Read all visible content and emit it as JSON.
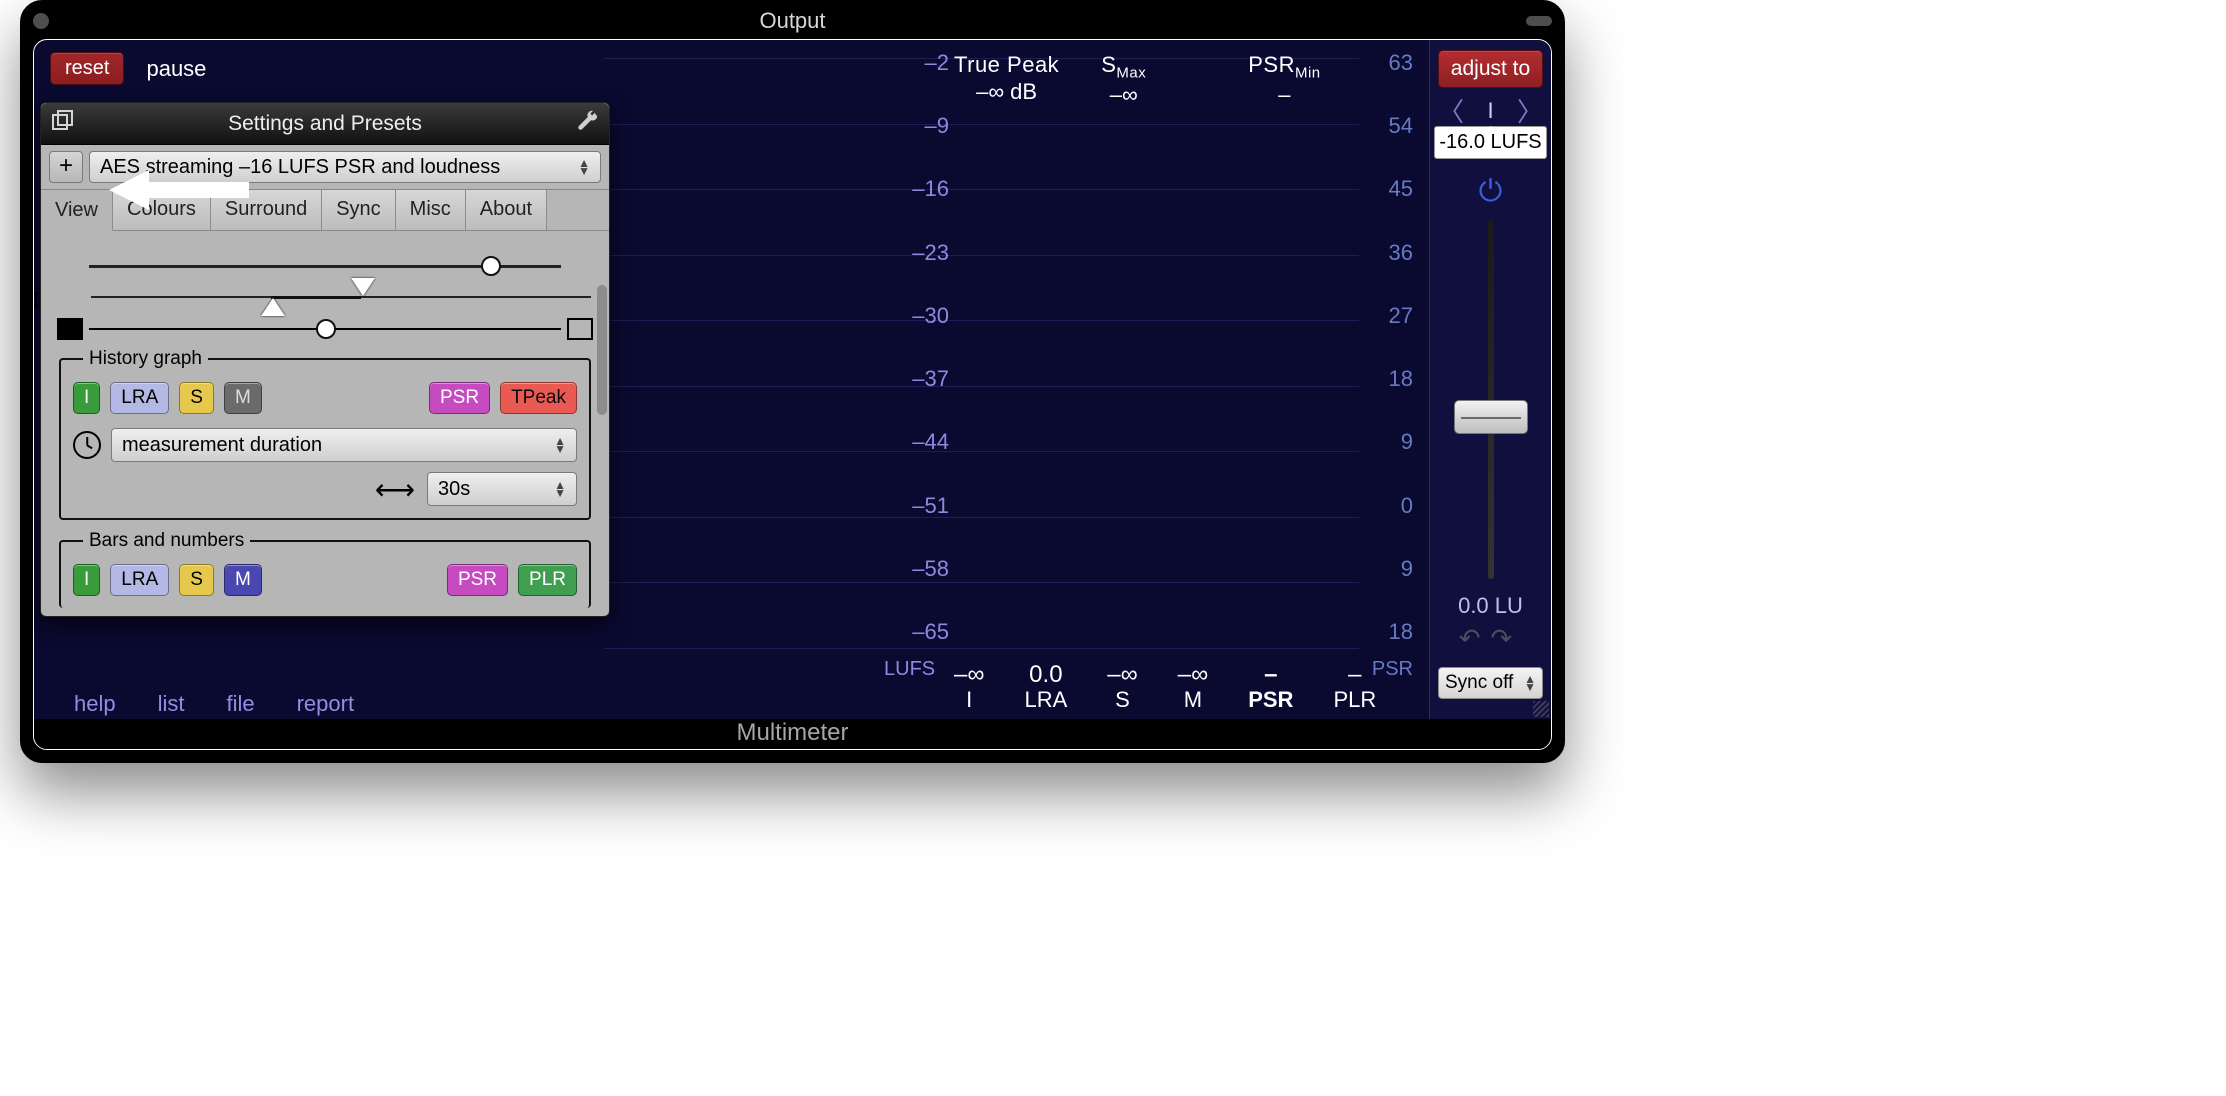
{
  "window": {
    "title": "Output",
    "app_name": "Multimeter"
  },
  "toolbar": {
    "reset_label": "reset",
    "pause_label": "pause"
  },
  "footer_links": [
    "help",
    "list",
    "file",
    "report"
  ],
  "top_stats": {
    "true_peak": {
      "label": "True Peak",
      "value": "–∞ dB"
    },
    "s_max": {
      "label": "S",
      "sub": "Max",
      "value": "–∞"
    },
    "psr_min": {
      "label": "PSR",
      "sub": "Min",
      "value": "–"
    }
  },
  "left_scale": {
    "unit": "LUFS",
    "ticks": [
      "–2",
      "–9",
      "–16",
      "–23",
      "–30",
      "–37",
      "–44",
      "–51",
      "–58",
      "–65"
    ]
  },
  "right_scale": {
    "unit": "PSR",
    "ticks": [
      "63",
      "54",
      "45",
      "36",
      "27",
      "18",
      "9",
      "0",
      "9",
      "18"
    ]
  },
  "bottom_readouts": [
    {
      "value": "–∞",
      "label": "I"
    },
    {
      "value": "0.0",
      "label": "LRA"
    },
    {
      "value": "–∞",
      "label": "S"
    },
    {
      "value": "–∞",
      "label": "M"
    },
    {
      "value": "–",
      "label": "PSR"
    },
    {
      "value": "–",
      "label": "PLR"
    }
  ],
  "right_strip": {
    "adjust_label": "adjust to",
    "mode": "I",
    "target": "-16.0 LUFS",
    "lu_readout": "0.0 LU",
    "sync_label": "Sync off"
  },
  "settings": {
    "title": "Settings and Presets",
    "preset_selected": "AES streaming –16 LUFS PSR and loudness",
    "tabs": [
      "View",
      "Colours",
      "Surround",
      "Sync",
      "Misc",
      "About"
    ],
    "active_tab": "View",
    "history_legend": "History graph",
    "history_chips": [
      "I",
      "LRA",
      "S",
      "M",
      "PSR",
      "TPeak"
    ],
    "duration_label": "measurement duration",
    "duration_value": "30s",
    "bars_legend": "Bars and numbers",
    "bars_chips": [
      "I",
      "LRA",
      "S",
      "M",
      "PSR",
      "PLR"
    ]
  }
}
